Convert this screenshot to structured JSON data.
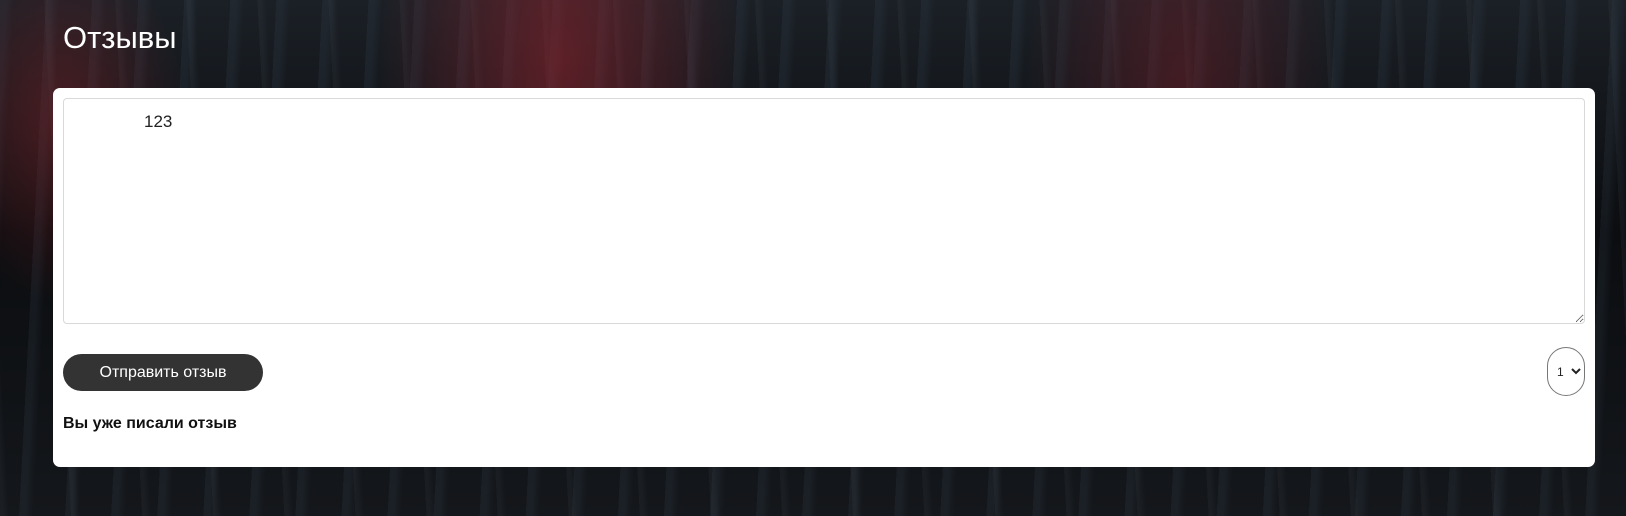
{
  "page": {
    "title": "Отзывы"
  },
  "review_form": {
    "textarea_value": "123",
    "submit_label": "Отправить отзыв",
    "rating_options": [
      "1"
    ],
    "rating_selected": "1",
    "status_message": "Вы уже писали отзыв"
  },
  "colors": {
    "card_background": "#ffffff",
    "button_background": "#333333",
    "title_color": "#ffffff"
  }
}
